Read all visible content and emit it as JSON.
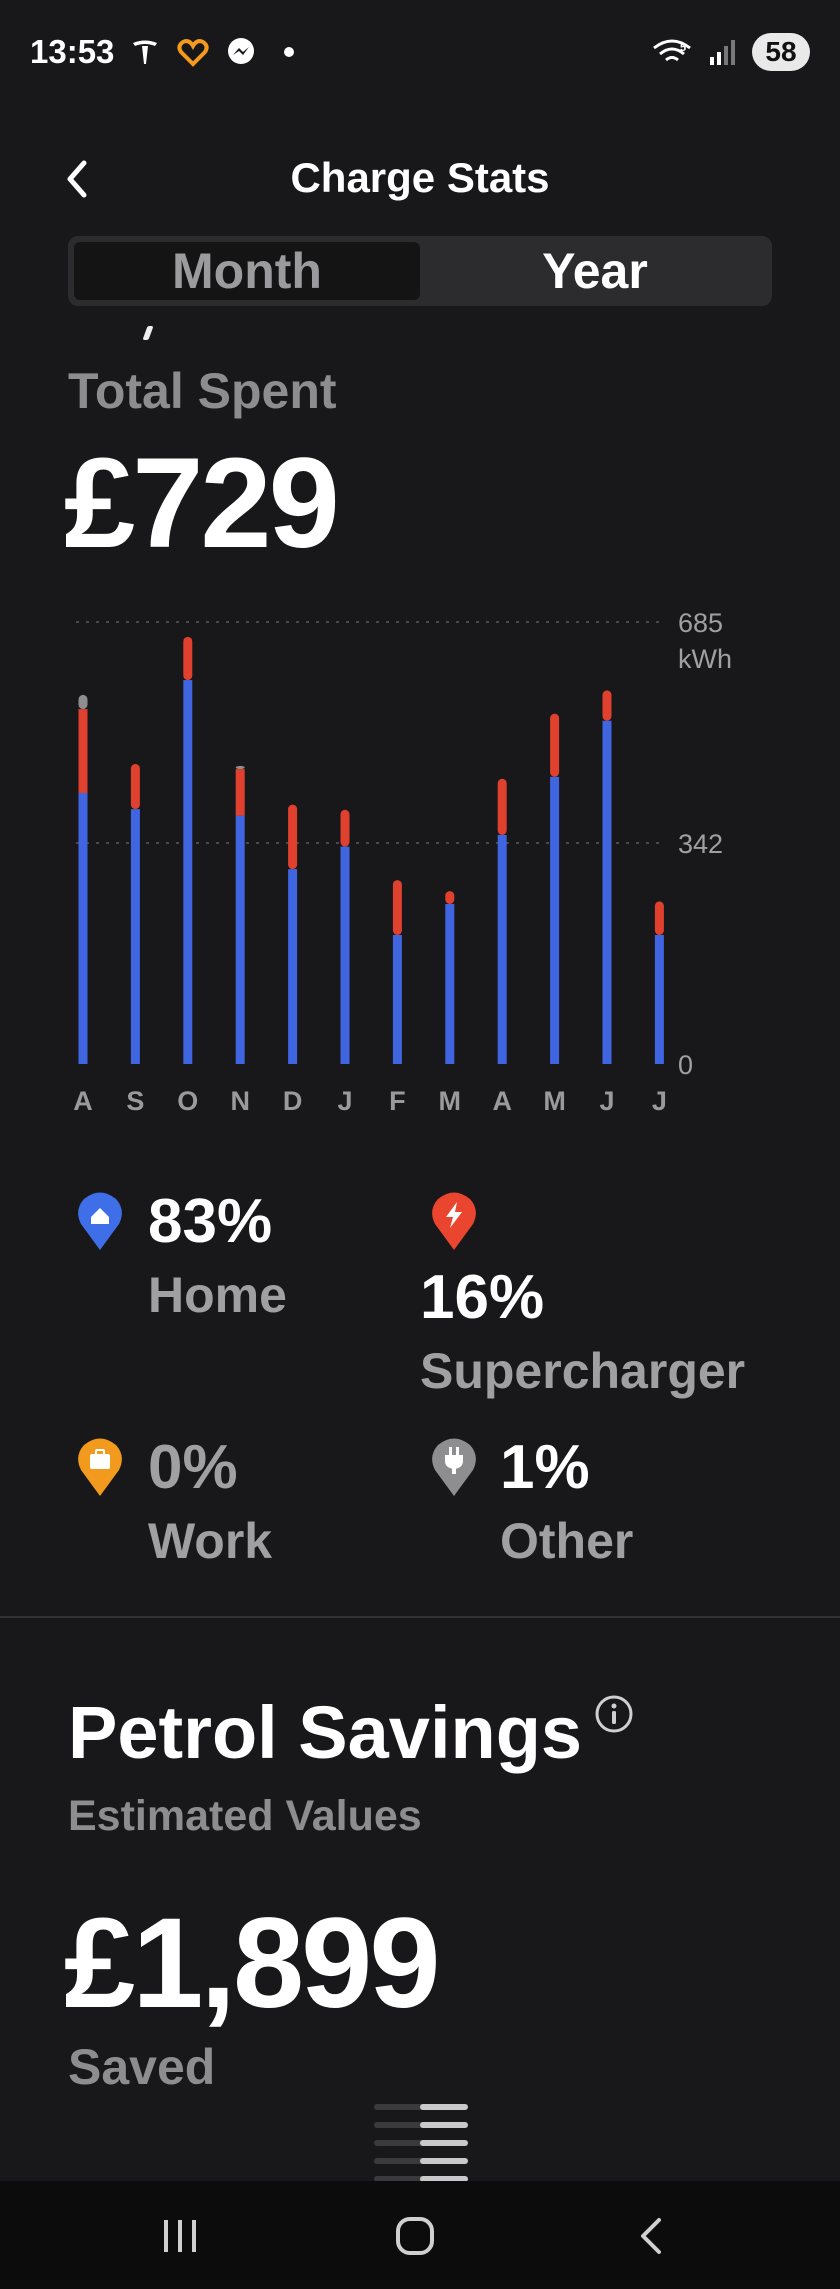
{
  "status_bar": {
    "time": "13:53",
    "battery": "58",
    "network_label": "5"
  },
  "header": {
    "title": "Charge Stats"
  },
  "period_toggle": {
    "options": [
      "Month",
      "Year"
    ],
    "selected": "Year"
  },
  "total": {
    "label": "Total Spent",
    "value": "£729"
  },
  "chart_data": {
    "type": "bar",
    "categories": [
      "A",
      "S",
      "O",
      "N",
      "D",
      "J",
      "F",
      "M",
      "A",
      "M",
      "J",
      "J"
    ],
    "series": [
      {
        "values": [
          420,
          395,
          595,
          385,
          302,
          337,
          200,
          248,
          355,
          445,
          532,
          200
        ]
      },
      {
        "values": [
          130,
          70,
          67,
          72,
          100,
          57,
          85,
          20,
          87,
          98,
          47,
          52
        ]
      },
      {
        "values": [
          22,
          0,
          0,
          5,
          0,
          0,
          0,
          0,
          0,
          0,
          0,
          0
        ]
      }
    ],
    "y_ticks": [
      "685",
      "342",
      "0"
    ],
    "y_unit": "kWh",
    "ylim": [
      0,
      685
    ],
    "colors": {
      "home": "#3f66e0",
      "supercharger": "#e0412e",
      "other": "#8e8e90"
    }
  },
  "legend": {
    "home": {
      "pct": "83%",
      "label": "Home",
      "color": "#3f6fe8"
    },
    "supercharger": {
      "pct": "16%",
      "label": "Supercharger",
      "color": "#e9452f"
    },
    "work": {
      "pct": "0%",
      "label": "Work",
      "color": "#f29a1d"
    },
    "other": {
      "pct": "1%",
      "label": "Other",
      "color": "#8e8e90"
    }
  },
  "petrol": {
    "title": "Petrol Savings",
    "subtitle": "Estimated Values",
    "value": "£1,899",
    "caption": "Saved"
  }
}
